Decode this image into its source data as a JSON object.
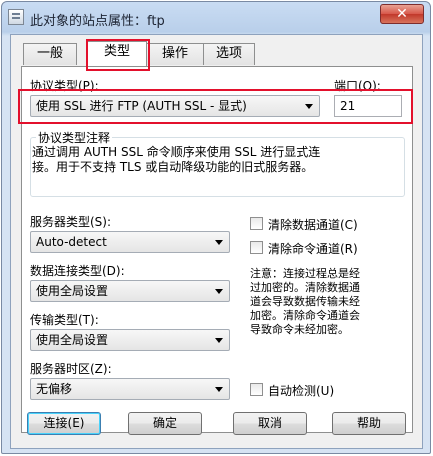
{
  "window": {
    "title": "此对象的站点属性：ftp",
    "close_label": "✕"
  },
  "tabs": [
    {
      "label": "一般"
    },
    {
      "label": "类型"
    },
    {
      "label": "操作"
    },
    {
      "label": "选项"
    }
  ],
  "protocol": {
    "label": "协议类型(P):",
    "value": "使用 SSL 进行 FTP (AUTH SSL - 显式)",
    "port_label": "端口(O):",
    "port_value": "21",
    "comment_title": "协议类型注释",
    "comment_lines": [
      "通过调用 AUTH SSL 命令顺序来使用 SSL 进行显式连",
      "接。用于不支持 TLS 或自动降级功能的旧式服务器。"
    ]
  },
  "server_type": {
    "label": "服务器类型(S):",
    "value": "Auto-detect"
  },
  "data_connection": {
    "label": "数据连接类型(D):",
    "value": "使用全局设置"
  },
  "transfer_type": {
    "label": "传输类型(T):",
    "value": "使用全局设置"
  },
  "timezone": {
    "label": "服务器时区(Z):",
    "value": "无偏移"
  },
  "options": {
    "clear_data_channel": "清除数据通道(C)",
    "clear_command_channel": "清除命令通道(R)",
    "auto_detect": "自动检测(U)",
    "note_lines": [
      "注意：连接过程总是经",
      "过加密的。清除数据通",
      "道会导致数据传输未经",
      "加密。清除命令通道会",
      "导致命令未经加密。"
    ]
  },
  "buttons": {
    "connect": "连接(E)",
    "ok": "确定",
    "cancel": "取消",
    "help": "帮助"
  },
  "colors": {
    "highlight_red": "#e3102c",
    "window_frame": "#b9cfea"
  }
}
